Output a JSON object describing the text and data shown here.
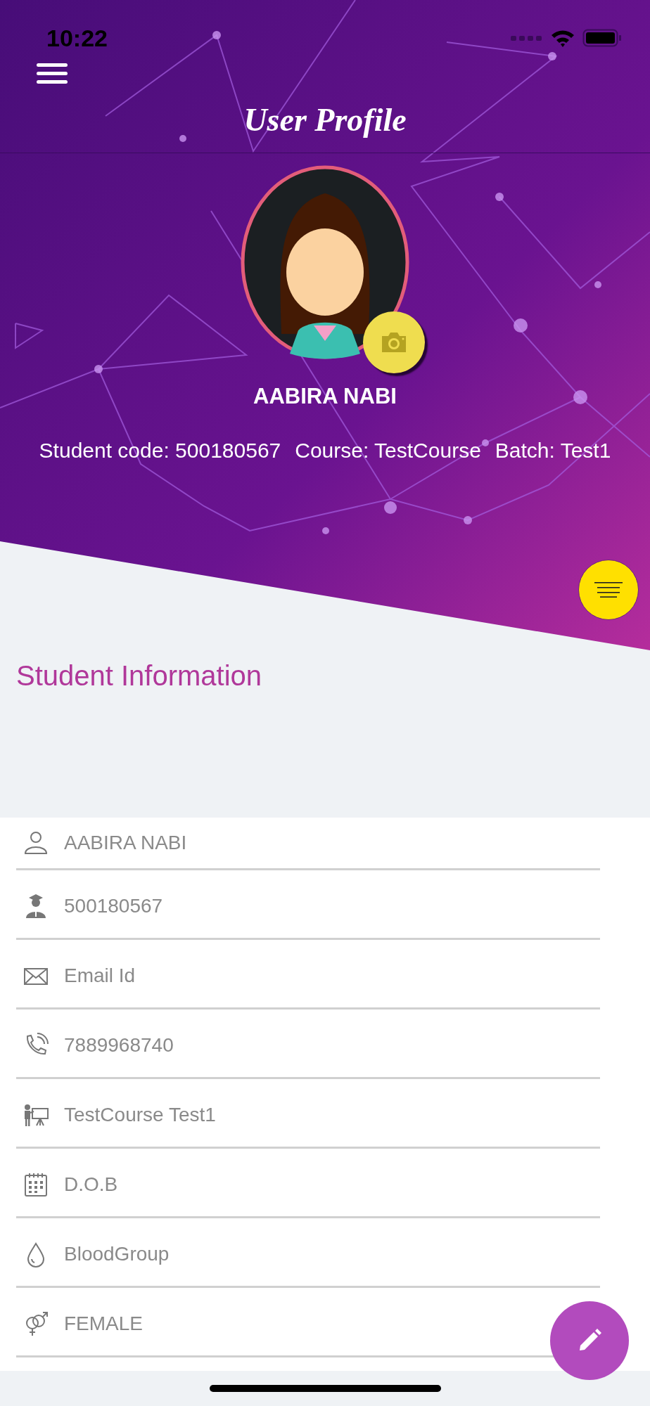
{
  "status_bar": {
    "time": "10:22"
  },
  "header": {
    "title": "User Profile"
  },
  "profile": {
    "name": "AABIRA NABI",
    "details": [
      "Student code: 500180567",
      "Course: TestCourse",
      "Batch: Test1"
    ]
  },
  "section": {
    "title": "Student Information"
  },
  "fields": [
    {
      "kind": "person",
      "value": "AABIRA NABI"
    },
    {
      "kind": "graduate",
      "value": "500180567"
    },
    {
      "kind": "mail",
      "placeholder": "Email Id"
    },
    {
      "kind": "phone",
      "value": "7889968740"
    },
    {
      "kind": "teacher",
      "value": "TestCourse Test1"
    },
    {
      "kind": "calendar",
      "placeholder": "D.O.B"
    },
    {
      "kind": "drop",
      "placeholder": "BloodGroup"
    },
    {
      "kind": "gender",
      "value": "FEMALE"
    }
  ]
}
